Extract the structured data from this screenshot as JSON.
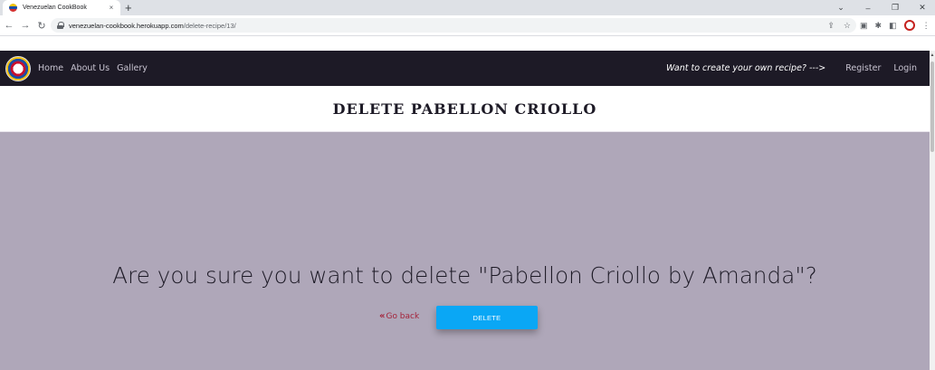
{
  "browser": {
    "tab_title": "Venezuelan CookBook",
    "tab_close": "×",
    "new_tab": "+",
    "url_host": "venezuelan-cookbook.herokuapp.com",
    "url_path": "/delete-recipe/13/",
    "window_controls": {
      "collapse": "⌄",
      "minimize": "–",
      "restore": "❐",
      "close": "✕"
    },
    "nav": {
      "back": "←",
      "forward": "→",
      "reload": "↻"
    },
    "omni_icons": {
      "share": "⇪",
      "bookmark": "☆"
    },
    "ext_icons": {
      "screenshot": "▣",
      "extensions": "✱",
      "sidepanel": "◧",
      "menu": "⋮"
    }
  },
  "site": {
    "nav_links": [
      "Home",
      "About Us",
      "Gallery"
    ],
    "cta_text": "Want to create your own recipe? --->",
    "register": "Register",
    "login": "Login"
  },
  "page": {
    "title": "DELETE PABELLON CRIOLLO",
    "question": "Are you sure you want to delete \"Pabellon Criollo by Amanda\"?",
    "go_back_icon": "«",
    "go_back_label": "Go back",
    "delete_label": "DELETE"
  },
  "colors": {
    "navbar": "#1d1a26",
    "main_bg": "#afa7b9",
    "delete_button": "#0aa7f5",
    "go_back": "#a4233a"
  }
}
